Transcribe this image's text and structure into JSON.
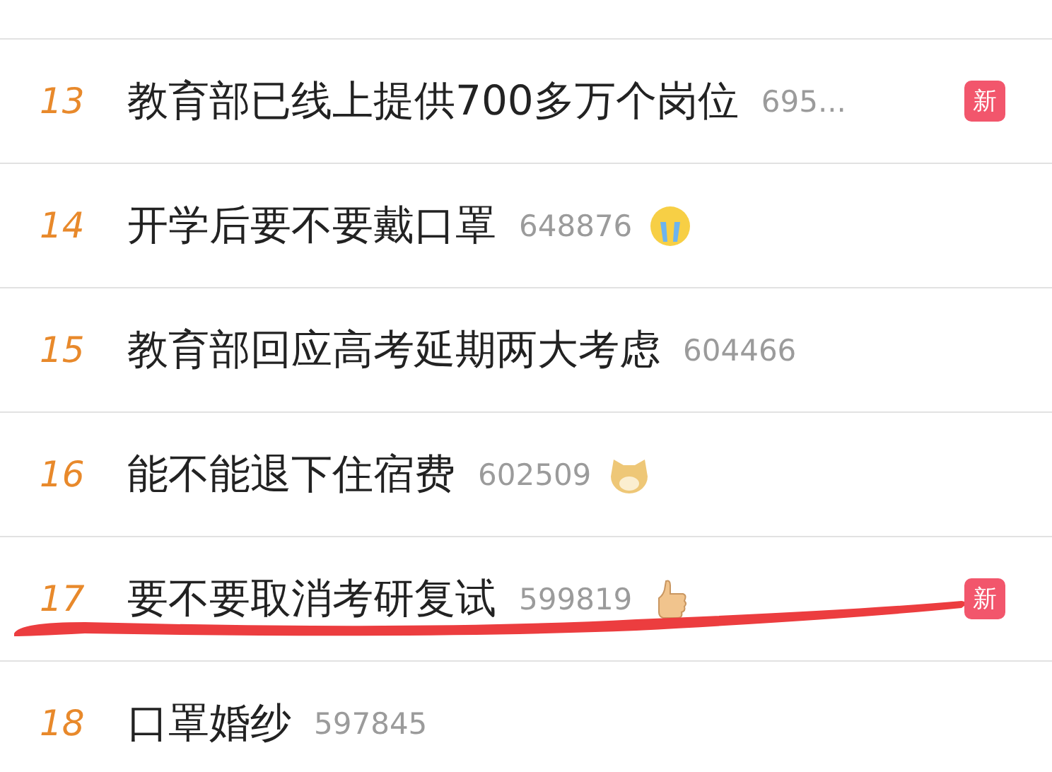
{
  "hot_search": [
    {
      "rank": "13",
      "title": "教育部已线上提供700多万个岗位",
      "count": "695...",
      "badge": "新"
    },
    {
      "rank": "14",
      "title": "开学后要不要戴口罩",
      "count": "648876",
      "kind": "crying"
    },
    {
      "rank": "15",
      "title": "教育部回应高考延期两大考虑",
      "count": "604466"
    },
    {
      "rank": "16",
      "title": "能不能退下住宿费",
      "count": "602509",
      "kind": "dog"
    },
    {
      "rank": "17",
      "title": "要不要取消考研复试",
      "count": "599819",
      "kind": "thumbs-up",
      "badge": "新"
    },
    {
      "rank": "18",
      "title": "口罩婚纱",
      "count": "597845"
    }
  ]
}
